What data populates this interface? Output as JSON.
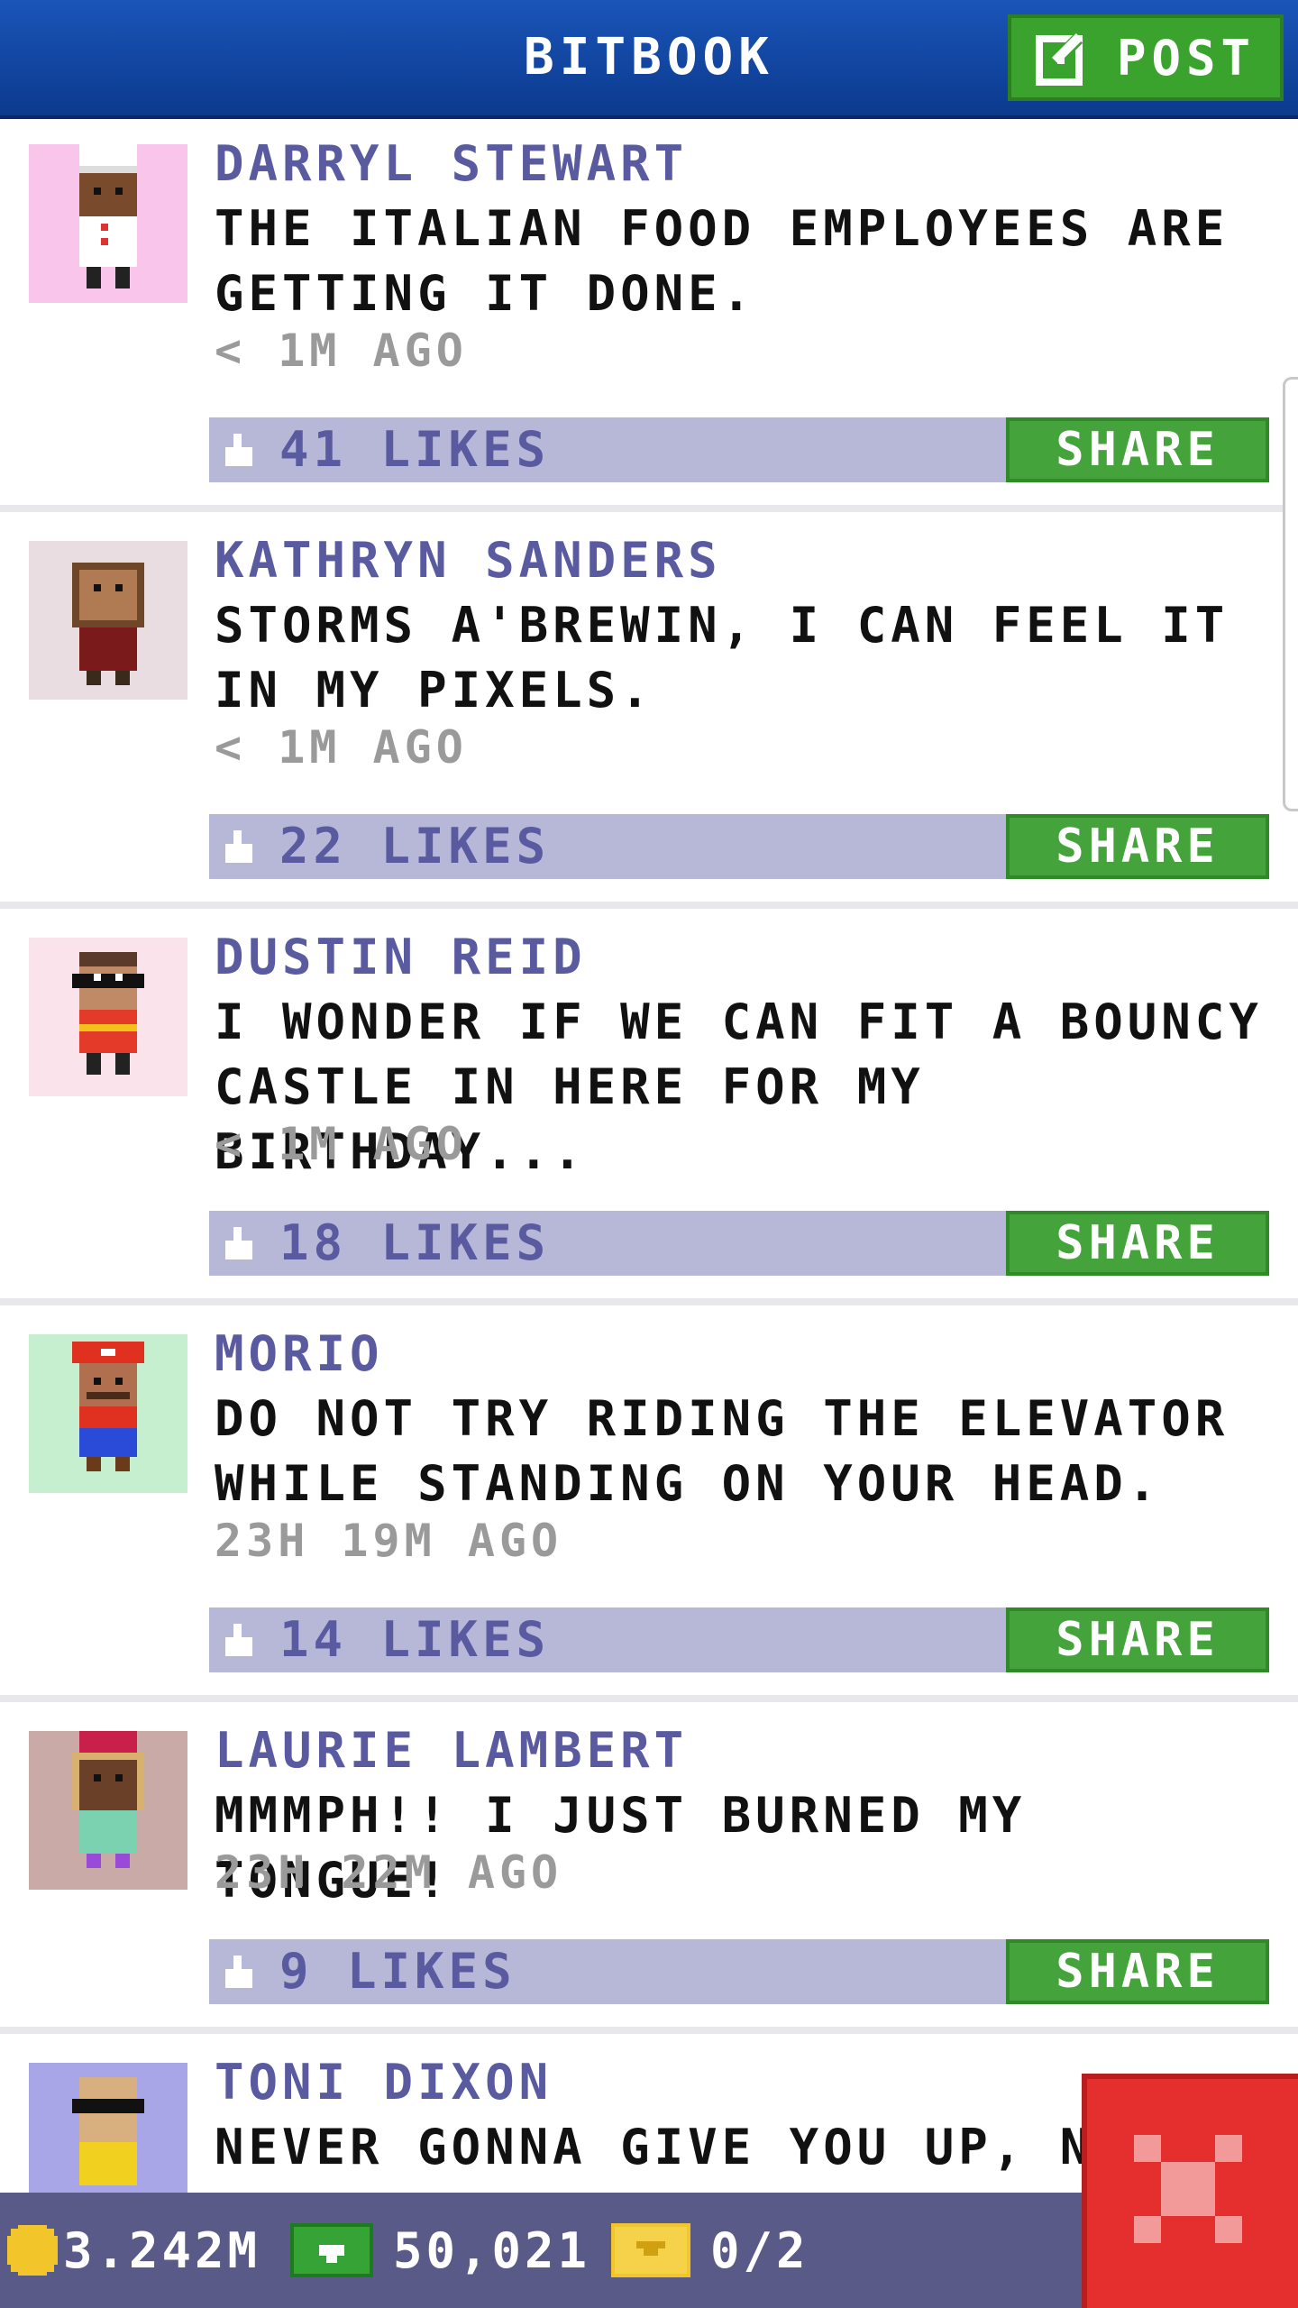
{
  "header": {
    "title": "BITBOOK",
    "post_label": "POST"
  },
  "posts": [
    {
      "author": "DARRYL STEWART",
      "message": "THE ITALIAN FOOD EMPLOYEES ARE GETTING IT DONE.",
      "time": "< 1M AGO",
      "likes": "41 LIKES",
      "share": "SHARE",
      "avatar_bg": "#f9c5ea"
    },
    {
      "author": "KATHRYN SANDERS",
      "message": "STORMS A'BREWIN, I CAN FEEL IT IN MY PIXELS.",
      "time": "< 1M AGO",
      "likes": "22 LIKES",
      "share": "SHARE",
      "avatar_bg": "#e9dde2"
    },
    {
      "author": "DUSTIN REID",
      "message": "I WONDER IF WE CAN FIT A BOUNCY CASTLE IN HERE FOR MY BIRTHDAY...",
      "time": "< 1M AGO",
      "likes": "18 LIKES",
      "share": "SHARE",
      "avatar_bg": "#fbe3ec"
    },
    {
      "author": "MORIO",
      "message": "DO NOT TRY RIDING THE ELEVATOR WHILE STANDING ON YOUR HEAD.",
      "time": "23H 19M AGO",
      "likes": "14 LIKES",
      "share": "SHARE",
      "avatar_bg": "#c6efcf"
    },
    {
      "author": "LAURIE LAMBERT",
      "message": "MMMPH!! I JUST BURNED MY TONGUE!",
      "time": "23H 22M AGO",
      "likes": "9 LIKES",
      "share": "SHARE",
      "avatar_bg": "#c9aaa6"
    },
    {
      "author": "TONI DIXON",
      "message": "NEVER GONNA GIVE YOU UP, NE",
      "avatar_bg": "#a8a6e6"
    }
  ],
  "bottom_bar": {
    "coins": "3.242M",
    "bux": "50,021",
    "tickets": "0/2"
  },
  "icons": {
    "post": "edit-icon",
    "like": "thumbs-up-icon",
    "coins": "coin-icon",
    "bux": "bux-icon",
    "tickets": "ticket-icon",
    "close": "close-icon"
  }
}
